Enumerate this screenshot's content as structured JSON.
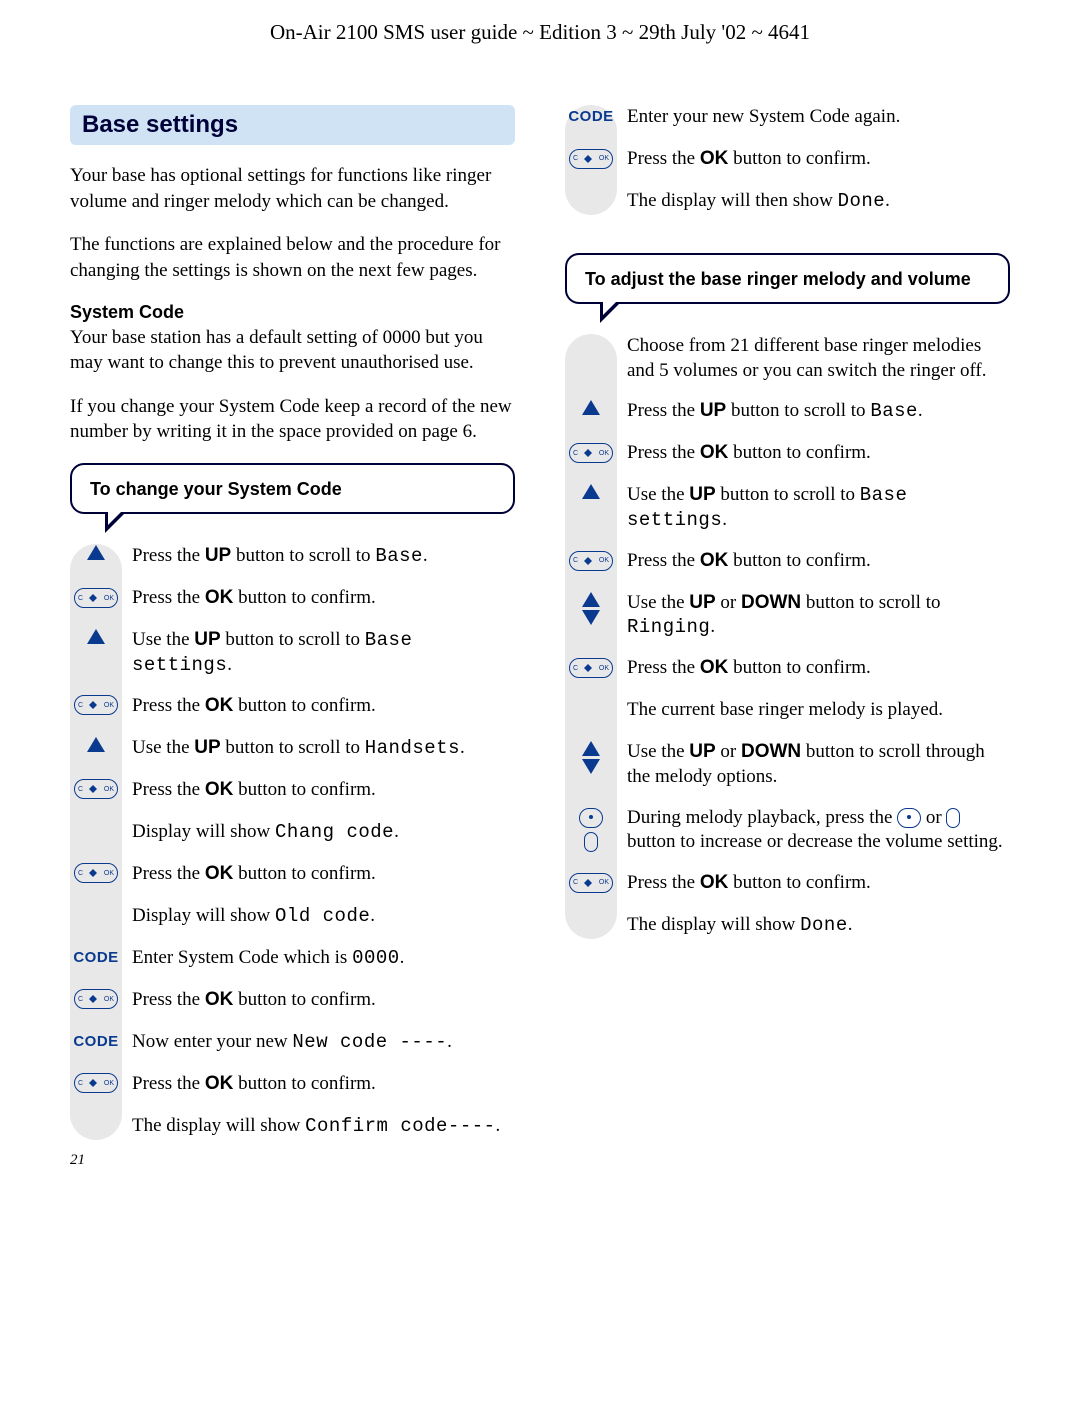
{
  "header": "On-Air 2100 SMS user guide ~ Edition 3 ~ 29th July '02 ~ 4641",
  "page_number": "21",
  "left": {
    "section_title": "Base settings",
    "intro1": "Your base has optional settings for functions like ringer volume and ringer melody which can be changed.",
    "intro2": "The functions are explained below and the procedure for changing the settings is shown on the next few pages.",
    "subhead": "System Code",
    "p1": "Your base station has a default setting of 0000 but you may want to change this to prevent unauthorised use.",
    "p2": "If you change your System Code keep a record of the new number by writing it in the space provided on page 6.",
    "callout": "To change your System Code",
    "code_label": "CODE",
    "steps": {
      "s1a": "Press the ",
      "s1b": "UP",
      "s1c": " button to scroll to ",
      "s1d": "Base",
      "s1e": ".",
      "s2a": "Press the ",
      "s2b": "OK",
      "s2c": " button to confirm.",
      "s3a": "Use the ",
      "s3b": "UP",
      "s3c": " button to scroll to ",
      "s3d": "Base settings",
      "s3e": ".",
      "s4a": "Press the ",
      "s4b": "OK",
      "s4c": " button to confirm.",
      "s5a": "Use the ",
      "s5b": "UP",
      "s5c": " button to scroll to ",
      "s5d": "Handsets",
      "s5e": ".",
      "s6a": "Press the ",
      "s6b": "OK",
      "s6c": " button to confirm.",
      "s7a": "Display will show ",
      "s7b": "Chang code",
      "s7c": ".",
      "s8a": "Press the ",
      "s8b": "OK",
      "s8c": " button to confirm.",
      "s9a": "Display will show ",
      "s9b": "Old code",
      "s9c": ".",
      "s10a": "Enter System Code which is ",
      "s10b": "0000",
      "s10c": ".",
      "s11a": "Press the ",
      "s11b": "OK",
      "s11c": " button to confirm.",
      "s12a": "Now enter your new ",
      "s12b": "New code ----",
      "s12c": ".",
      "s13a": "Press the ",
      "s13b": "OK",
      "s13c": " button to confirm.",
      "s14a": "The display will show ",
      "s14b": "Confirm code----",
      "s14c": "."
    }
  },
  "right": {
    "top_steps": {
      "code_label": "CODE",
      "s1": "Enter your new System Code again.",
      "s2a": "Press the ",
      "s2b": "OK",
      "s2c": " button to confirm.",
      "s3a": "The display will then show ",
      "s3b": "Done",
      "s3c": "."
    },
    "callout": "To adjust the base ringer melody and volume",
    "steps": {
      "s1": "Choose from 21 different base ringer melodies and 5 volumes or you can switch the ringer off.",
      "s2a": "Press the ",
      "s2b": "UP",
      "s2c": " button to scroll to ",
      "s2d": "Base",
      "s2e": ".",
      "s3a": "Press the ",
      "s3b": "OK",
      "s3c": " button to confirm.",
      "s4a": "Use the ",
      "s4b": "UP",
      "s4c": " button to scroll to ",
      "s4d": "Base settings",
      "s4e": ".",
      "s5a": "Press the ",
      "s5b": "OK",
      "s5c": " button to confirm.",
      "s6a": "Use the ",
      "s6b": "UP",
      "s6c": " or ",
      "s6d": "DOWN",
      "s6e": " button to scroll to ",
      "s6f": "Ringing",
      "s6g": ".",
      "s7a": "Press the ",
      "s7b": "OK",
      "s7c": " button to confirm.",
      "s8": "The current base ringer melody is played.",
      "s9a": "Use the ",
      "s9b": "UP",
      "s9c": " or ",
      "s9d": "DOWN",
      "s9e": " button to scroll through the melody options.",
      "s10a": "During melody playback, press the ",
      "s10b": " or ",
      "s10c": " button to increase or decrease the volume setting.",
      "s11a": "Press the ",
      "s11b": "OK",
      "s11c": " button to confirm.",
      "s12a": "The display will show ",
      "s12b": "Done",
      "s12c": "."
    }
  }
}
